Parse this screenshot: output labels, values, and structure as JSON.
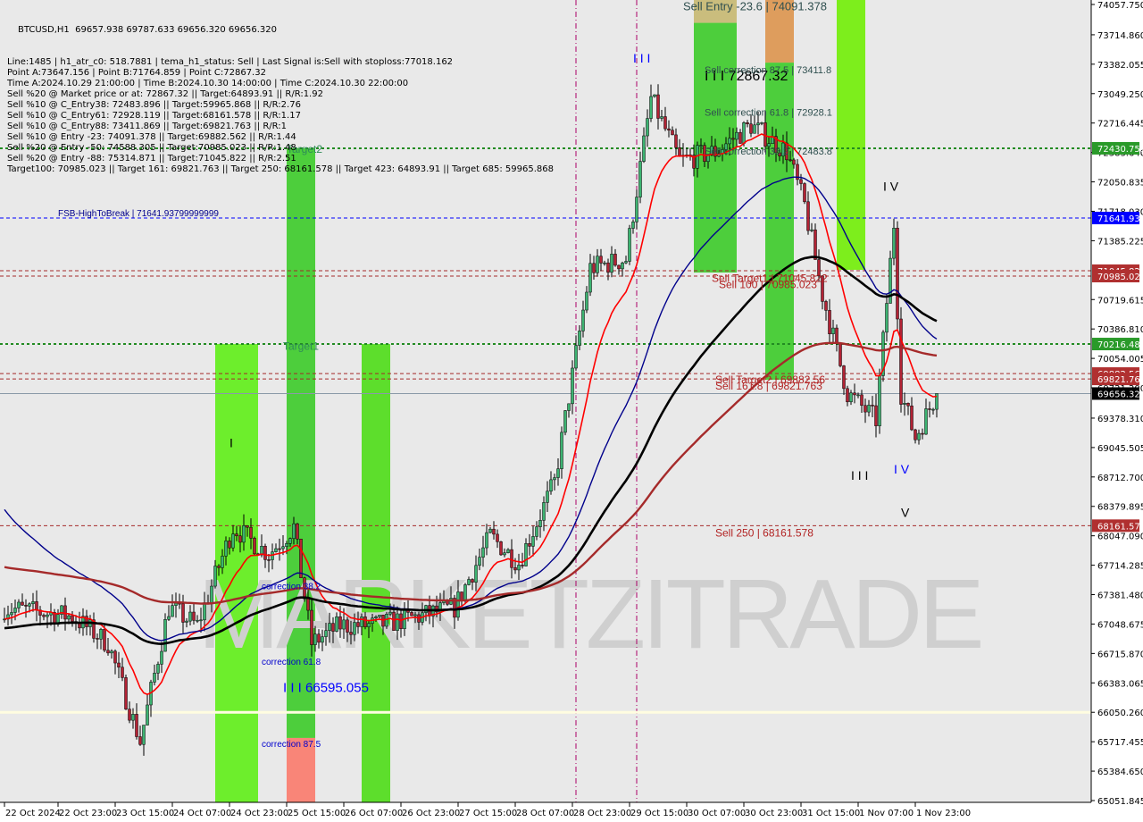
{
  "info": {
    "title": "BTCUSD,H1  69657.938 69787.633 69656.320 69656.320",
    "lines": [
      "Line:1485 | h1_atr_c0: 518.7881 | tema_h1_status: Sell | Last Signal is:Sell with stoploss:77018.162",
      "Point A:73647.156 | Point B:71764.859 | Point C:72867.32",
      "Time A:2024.10.29 21:00:00 | Time B:2024.10.30 14:00:00 | Time C:2024.10.30 22:00:00",
      "Sell %20 @ Market price or at: 72867.32 || Target:64893.91 || R/R:1.92",
      "Sell %10 @ C_Entry38: 72483.896 || Target:59965.868 || R/R:2.76",
      "Sell %10 @ C_Entry61: 72928.119 || Target:68161.578 || R/R:1.17",
      "Sell %10 @ C_Entry88: 73411.869 || Target:69821.763 || R/R:1",
      "Sell %10 @ Entry -23: 74091.378 || Target:69882.562 || R/R:1.44",
      "Sell %20 @ Entry -50: 74588.305 || Target:70985.023 || R/R:1.48",
      "Sell %20 @ Entry -88: 75314.871 || Target:71045.822 || R/R:2.51",
      "Target100: 70985.023 || Target 161: 69821.763 || Target 250: 68161.578 || Target 423: 64893.91 || Target 685: 59965.868"
    ]
  },
  "watermark": "MARKETZITRADE",
  "chart_data": {
    "type": "candlestick",
    "symbol": "BTCUSD",
    "timeframe": "H1",
    "ylim": [
      65051.845,
      74057.75
    ],
    "y_ticks": [
      "74057.750",
      "73714.860",
      "73382.055",
      "73049.250",
      "72716.445",
      "72383.640",
      "72050.835",
      "71718.030",
      "71385.225",
      "70719.615",
      "70386.810",
      "70054.005",
      "69721.200",
      "69378.310",
      "69045.505",
      "68712.700",
      "68379.895",
      "68047.090",
      "67714.285",
      "67381.480",
      "67048.675",
      "66715.870",
      "66383.065",
      "66050.260",
      "65717.455",
      "65384.650",
      "65051.845"
    ],
    "x_ticks": [
      "22 Oct 2024",
      "22 Oct 23:00",
      "23 Oct 15:00",
      "24 Oct 07:00",
      "24 Oct 23:00",
      "25 Oct 15:00",
      "26 Oct 07:00",
      "26 Oct 23:00",
      "27 Oct 15:00",
      "28 Oct 07:00",
      "28 Oct 23:00",
      "29 Oct 15:00",
      "30 Oct 07:00",
      "30 Oct 23:00",
      "31 Oct 15:00",
      "1 Nov 07:00",
      "1 Nov 23:00"
    ],
    "price_path": [
      {
        "t": "2024-10-22 08:00",
        "c": 67235
      },
      {
        "t": "2024-10-23 03:00",
        "c": 67134
      },
      {
        "t": "2024-10-23 13:00",
        "c": 66831
      },
      {
        "t": "2024-10-23 22:00",
        "c": 65719
      },
      {
        "t": "2024-10-24 06:00",
        "c": 67235
      },
      {
        "t": "2024-10-24 14:00",
        "c": 67033
      },
      {
        "t": "2024-10-25 00:00",
        "c": 68145
      },
      {
        "t": "2024-10-25 10:00",
        "c": 67842
      },
      {
        "t": "2024-10-25 17:00",
        "c": 68145
      },
      {
        "t": "2024-10-25 22:00",
        "c": 66831
      },
      {
        "t": "2024-10-26 06:00",
        "c": 67033
      },
      {
        "t": "2024-10-26 16:00",
        "c": 67033
      },
      {
        "t": "2024-10-27 04:00",
        "c": 67134
      },
      {
        "t": "2024-10-27 14:00",
        "c": 67235
      },
      {
        "t": "2024-10-28 00:00",
        "c": 68044
      },
      {
        "t": "2024-10-28 08:00",
        "c": 67741
      },
      {
        "t": "2024-10-28 18:00",
        "c": 68650
      },
      {
        "t": "2024-10-29 04:00",
        "c": 71076
      },
      {
        "t": "2024-10-29 14:00",
        "c": 71177
      },
      {
        "t": "2024-10-29 21:00",
        "c": 72996
      },
      {
        "t": "2024-10-30 05:00",
        "c": 72289
      },
      {
        "t": "2024-10-30 15:00",
        "c": 72390
      },
      {
        "t": "2024-10-31 01:00",
        "c": 72693
      },
      {
        "t": "2024-10-31 11:00",
        "c": 72390
      },
      {
        "t": "2024-10-31 16:00",
        "c": 71784
      },
      {
        "t": "2024-10-31 21:00",
        "c": 70773
      },
      {
        "t": "2024-11-01 04:00",
        "c": 69661
      },
      {
        "t": "2024-11-01 12:00",
        "c": 69358
      },
      {
        "t": "2024-11-01 17:00",
        "c": 71581
      },
      {
        "t": "2024-11-01 19:00",
        "c": 69661
      },
      {
        "t": "2024-11-01 23:00",
        "c": 69156
      },
      {
        "t": "2024-11-02 05:00",
        "c": 69656
      }
    ],
    "levels": [
      {
        "price": 72430.751,
        "label": "72430.751",
        "color": "#228b22",
        "style": "dotted"
      },
      {
        "price": 71641.938,
        "label": "71641.938",
        "color": "#0000ff",
        "style": "dashed"
      },
      {
        "price": 71045.822,
        "label": "71045.822",
        "color": "#a52a2a",
        "style": "dashed"
      },
      {
        "price": 70985.023,
        "label": "70985.023",
        "color": "#a52a2a",
        "style": "dashed"
      },
      {
        "price": 70216.483,
        "label": "70216.483",
        "color": "#228b22",
        "style": "dotted"
      },
      {
        "price": 69882.562,
        "label": "69882.562",
        "color": "#a52a2a",
        "style": "dashed"
      },
      {
        "price": 69821.763,
        "label": "69821.763",
        "color": "#a52a2a",
        "style": "dashed"
      },
      {
        "price": 69656.32,
        "label": "69656.320",
        "color": "#000000",
        "style": "solid"
      },
      {
        "price": 68161.578,
        "label": "68161.578",
        "color": "#a52a2a",
        "style": "dashed"
      },
      {
        "price": 66050.26,
        "label": "",
        "color": "#fffde0",
        "style": "solid"
      }
    ],
    "vlines": [
      {
        "t": "2024-10-29 00:00",
        "color": "#aa0066"
      },
      {
        "t": "2024-10-29 17:00",
        "color": "#aa0066"
      }
    ],
    "zones": [
      {
        "t0": "2024-10-24 19:00",
        "t1": "2024-10-25 07:00",
        "top": 70216.483,
        "bottom": 65000,
        "color": "#66ee22"
      },
      {
        "t0": "2024-10-25 15:00",
        "t1": "2024-10-25 23:00",
        "top": 72430.751,
        "bottom": 65760,
        "color": "#44cc33"
      },
      {
        "t0": "2024-10-25 15:00",
        "t1": "2024-10-25 23:00",
        "top": 65760,
        "bottom": 65000,
        "color": "#fa8072"
      },
      {
        "t0": "2024-10-26 12:00",
        "t1": "2024-10-26 20:00",
        "top": 70216.483,
        "bottom": 65000,
        "color": "#55dd22"
      },
      {
        "t0": "2024-10-30 09:00",
        "t1": "2024-10-30 21:00",
        "top": 73850,
        "bottom": 71025,
        "color": "#44cc33"
      },
      {
        "t0": "2024-10-30 09:00",
        "t1": "2024-10-30 21:00",
        "top": 74200,
        "bottom": 73850,
        "color": "#c8bb77"
      },
      {
        "t0": "2024-10-31 05:00",
        "t1": "2024-10-31 13:00",
        "top": 73400,
        "bottom": 69812,
        "color": "#44cc33"
      },
      {
        "t0": "2024-10-31 05:00",
        "t1": "2024-10-31 13:00",
        "top": 74200,
        "bottom": 73400,
        "color": "#dd9955"
      },
      {
        "t0": "2024-11-01 01:00",
        "t1": "2024-11-01 09:00",
        "top": 74200,
        "bottom": 71056,
        "color": "#77ee11"
      }
    ],
    "annotations": [
      {
        "text": "Target2",
        "t": "2024-10-25 15:00",
        "price": 72380,
        "color": "#2e8b57",
        "size": 12
      },
      {
        "text": "Target1",
        "t": "2024-10-25 14:00",
        "price": 70150,
        "color": "#2e8b57",
        "size": 12
      },
      {
        "text": "FSB-HighToBreak | 71641.93799999999",
        "t": "2024-10-22 23:00",
        "price": 71660,
        "color": "#00008b",
        "size": 10
      },
      {
        "text": "correction 38.2",
        "t": "2024-10-25 08:00",
        "price": 67440,
        "color": "#0000cd",
        "size": 10
      },
      {
        "text": "correction 61.8",
        "t": "2024-10-25 08:00",
        "price": 66590,
        "color": "#0000cd",
        "size": 10
      },
      {
        "text": "correction 87.5",
        "t": "2024-10-25 08:00",
        "price": 65660,
        "color": "#0000cd",
        "size": 10
      },
      {
        "text": "I I I  66595.055",
        "t": "2024-10-25 14:00",
        "price": 66280,
        "color": "#0000ff",
        "size": 15
      },
      {
        "text": "Sell Entry -23.6 | 74091.378",
        "t": "2024-10-30 06:00",
        "price": 73990,
        "color": "#2f4f4f",
        "size": 13
      },
      {
        "text": "I I I  72867.32",
        "t": "2024-10-30 12:00",
        "price": 73200,
        "color": "#000000",
        "size": 16
      },
      {
        "text": "Sell correction 87.5 | 73411.8",
        "t": "2024-10-30 12:00",
        "price": 73280,
        "color": "#2f4f4f",
        "size": 11
      },
      {
        "text": "Sell correction 61.8 | 72928.1",
        "t": "2024-10-30 12:00",
        "price": 72800,
        "color": "#2f4f4f",
        "size": 11
      },
      {
        "text": "Sell correction 38.2 | 72483.8",
        "t": "2024-10-30 12:00",
        "price": 72360,
        "color": "#2f4f4f",
        "size": 11
      },
      {
        "text": "Sell Target1 | 71045.822",
        "t": "2024-10-30 14:00",
        "price": 70920,
        "color": "#b22222",
        "size": 12
      },
      {
        "text": "Sell 100 | 70985.023",
        "t": "2024-10-30 16:00",
        "price": 70850,
        "color": "#b22222",
        "size": 12
      },
      {
        "text": "Sell Target2 | 69882.56",
        "t": "2024-10-30 15:00",
        "price": 69770,
        "color": "#b22222",
        "size": 12
      },
      {
        "text": "Sell 161.8 | 69821.763",
        "t": "2024-10-30 15:00",
        "price": 69700,
        "color": "#b22222",
        "size": 12
      },
      {
        "text": "Sell 250 | 68161.578",
        "t": "2024-10-30 15:00",
        "price": 68040,
        "color": "#b22222",
        "size": 12
      },
      {
        "text": "I",
        "t": "2024-10-24 23:00",
        "price": 69050,
        "color": "#000000",
        "size": 14
      },
      {
        "text": "I I I",
        "t": "2024-10-29 16:00",
        "price": 73400,
        "color": "#0000ff",
        "size": 14
      },
      {
        "text": "I V",
        "t": "2024-11-01 14:00",
        "price": 71950,
        "color": "#000000",
        "size": 14
      },
      {
        "text": "I I I",
        "t": "2024-11-01 05:00",
        "price": 68680,
        "color": "#000000",
        "size": 14
      },
      {
        "text": "I V",
        "t": "2024-11-01 17:00",
        "price": 68750,
        "color": "#0000ff",
        "size": 14
      },
      {
        "text": "V",
        "t": "2024-11-01 19:00",
        "price": 68260,
        "color": "#000000",
        "size": 14
      }
    ],
    "colors": {
      "bull": "#3cb371",
      "bear": "#b22234",
      "ma_fast": "#ff0000",
      "ma_mid": "#00008b",
      "ma_slow": "#000000",
      "ma_long": "#a52a2a"
    }
  }
}
